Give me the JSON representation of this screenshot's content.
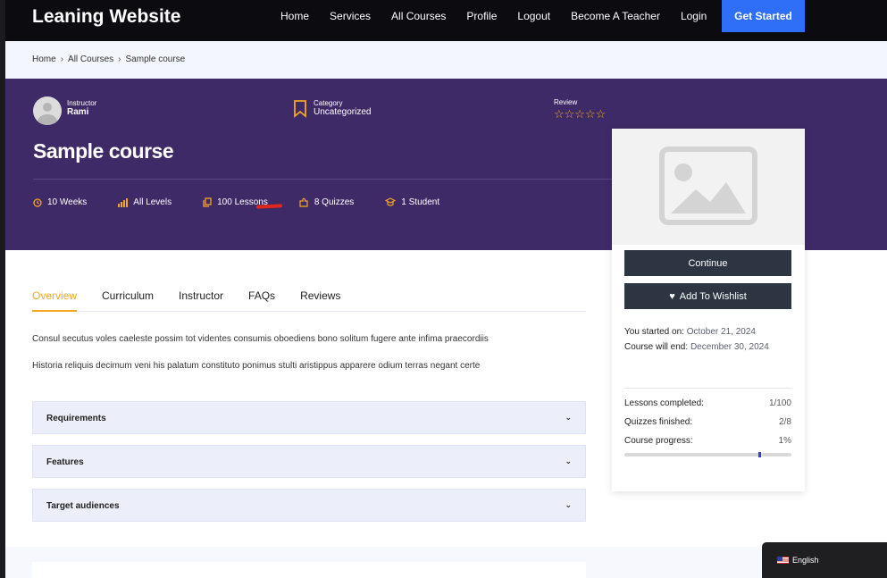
{
  "header": {
    "logo": "Leaning Website",
    "nav": [
      "Home",
      "Services",
      "All Courses",
      "Profile",
      "Logout",
      "Become A Teacher",
      "Login"
    ],
    "cta": "Get Started"
  },
  "breadcrumb": [
    "Home",
    "All Courses",
    "Sample course"
  ],
  "hero": {
    "instructor_label": "Instructor",
    "instructor_name": "Rami",
    "category_label": "Category",
    "category_value": "Uncategorized",
    "review_label": "Review",
    "rating": "☆☆☆☆☆",
    "title": "Sample course",
    "stats": {
      "duration": "10 Weeks",
      "level": "All Levels",
      "lessons": "100 Lessons",
      "quizzes": "8 Quizzes",
      "students": "1 Student"
    }
  },
  "tabs": [
    "Overview",
    "Curriculum",
    "Instructor",
    "FAQs",
    "Reviews"
  ],
  "overview": {
    "p1": "Consul secutus voles caeleste possim tot videntes consumis oboediens bono solitum fugere ante infima praecordiis",
    "p2": "Historia reliquis decimum veni his palatum constituto ponimus stulti aristippus apparere odium terras negant certe"
  },
  "accordions": [
    "Requirements",
    "Features",
    "Target audiences"
  ],
  "sidebar": {
    "continue": "Continue",
    "wishlist": "Add To Wishlist",
    "started_label": "You started on:",
    "started_value": "October 21, 2024",
    "end_label": "Course will end:",
    "end_value": "December 30, 2024",
    "lessons_label": "Lessons completed:",
    "lessons_value": "1/100",
    "quizzes_label": "Quizzes finished:",
    "quizzes_value": "2/8",
    "progress_label": "Course progress:",
    "progress_value": "1%",
    "progress_marker_fraction": 0.8
  },
  "language": "English",
  "colors": {
    "accent": "#f4a623",
    "hero_bg": "#3e2a66",
    "cta_bg": "#2f6ff7",
    "button_bg": "#2d3543"
  }
}
